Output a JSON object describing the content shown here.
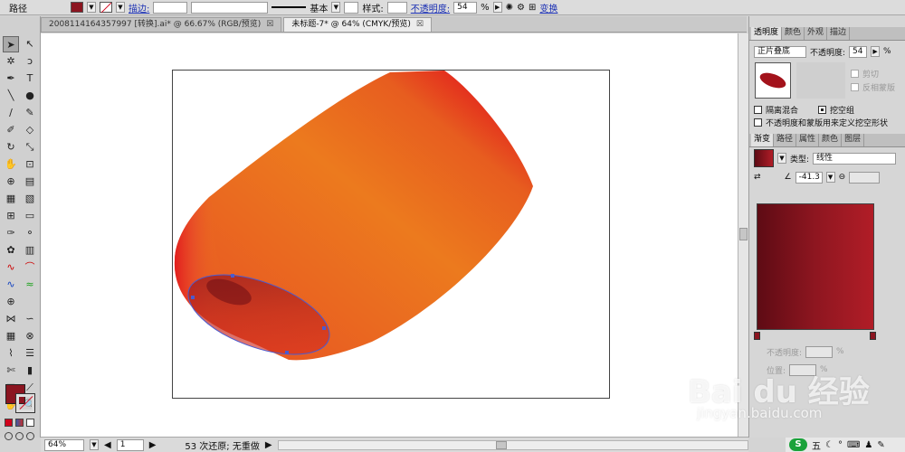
{
  "control_bar": {
    "object_label": "路径",
    "stroke_label": "描边:",
    "stroke_profile": "基本",
    "style_label": "样式:",
    "opacity_label": "不透明度:",
    "opacity_value": "54",
    "opacity_unit": "%",
    "transform_label": "变换",
    "fill_color": "#8b1520"
  },
  "doc_tabs": [
    {
      "title": "2008114164357997 [转换].ai* @ 66.67% (RGB/预览)",
      "close": "☒"
    },
    {
      "title": "未标题-7* @ 64% (CMYK/预览)",
      "close": "☒"
    }
  ],
  "status_bar": {
    "zoom": "64%",
    "page": "1",
    "history": "53 次还原; 无重做"
  },
  "transparency_panel": {
    "tabs": [
      "透明度",
      "颜色",
      "外观",
      "描边"
    ],
    "blend_mode": "正片叠底",
    "opacity_label": "不透明度:",
    "opacity_value": "54",
    "opacity_unit": "%",
    "clip_label": "剪切",
    "invert_mask_label": "反相蒙版",
    "isolate_label": "隔离混合",
    "knockout_label": "挖空组",
    "define_knockout_label": "不透明度和蒙版用来定义挖空形状"
  },
  "gradient_panel": {
    "tabs": [
      "渐变",
      "路径",
      "属性",
      "颜色",
      "图层"
    ],
    "type_label": "类型:",
    "type_value": "线性",
    "angle_value": "-41.3",
    "opacity_label": "不透明度:",
    "location_label": "位置:",
    "unit": "%",
    "stop_color": "#8b1520",
    "gradient_colors": [
      "#5e0b14",
      "#b11d27"
    ]
  },
  "tray": {
    "ime_label": "五",
    "logo_text": "S"
  },
  "watermark": {
    "main": "Bai du 经验",
    "sub": "jingyan.baidu.com"
  }
}
